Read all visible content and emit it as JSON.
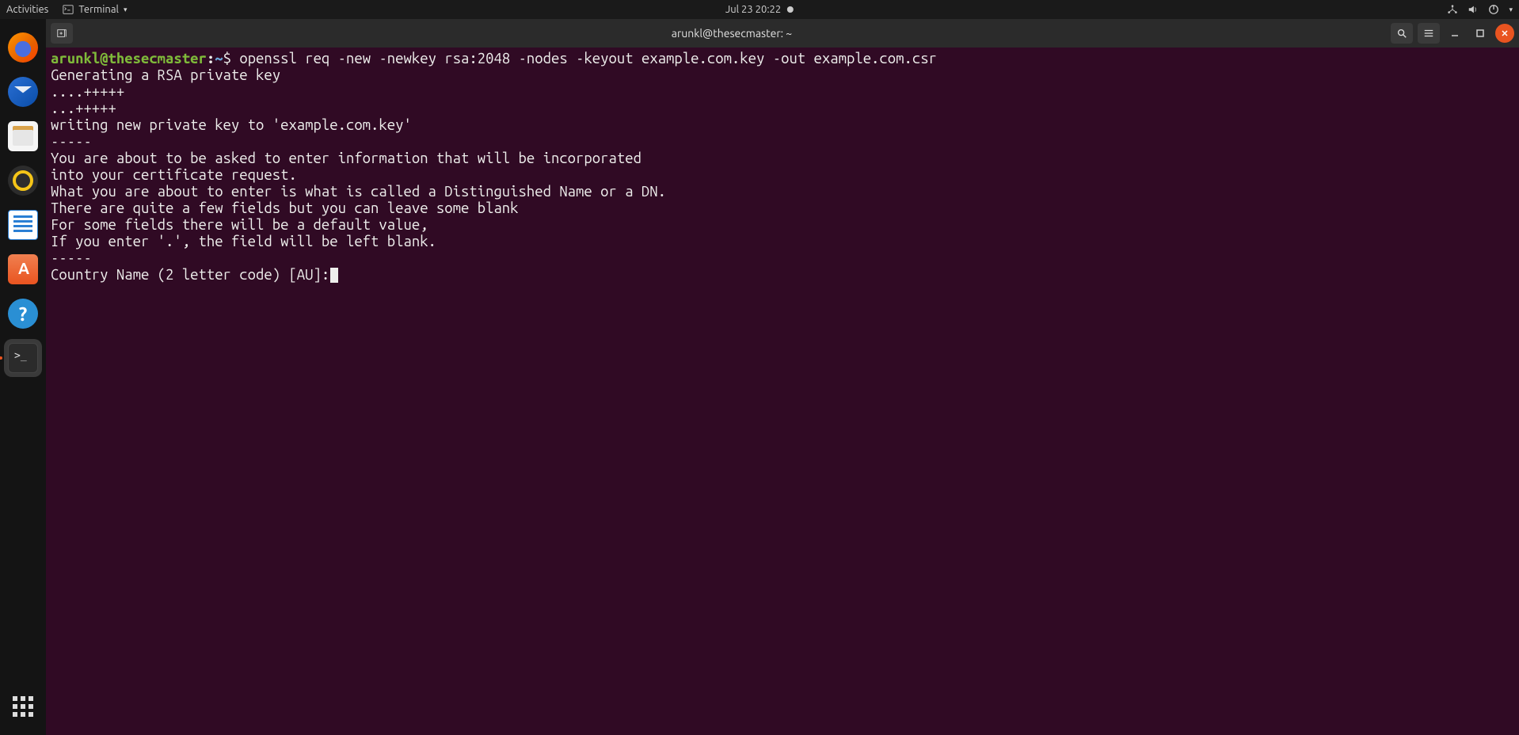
{
  "top_panel": {
    "activities": "Activities",
    "app_menu": "Terminal",
    "clock": "Jul 23  20:22"
  },
  "dock": {
    "items": [
      {
        "name": "firefox"
      },
      {
        "name": "thunderbird"
      },
      {
        "name": "files"
      },
      {
        "name": "rhythmbox"
      },
      {
        "name": "libreoffice-writer"
      },
      {
        "name": "ubuntu-software"
      },
      {
        "name": "help"
      },
      {
        "name": "terminal"
      }
    ]
  },
  "window": {
    "title": "arunkl@thesecmaster: ~"
  },
  "terminal": {
    "prompt_user": "arunkl@thesecmaster",
    "prompt_sep": ":",
    "prompt_path": "~",
    "prompt_dollar": "$ ",
    "command": "openssl req -new -newkey rsa:2048 -nodes -keyout example.com.key -out example.com.csr",
    "lines": [
      "Generating a RSA private key",
      "....+++++",
      "...+++++",
      "writing new private key to 'example.com.key'",
      "-----",
      "You are about to be asked to enter information that will be incorporated",
      "into your certificate request.",
      "What you are about to enter is what is called a Distinguished Name or a DN.",
      "There are quite a few fields but you can leave some blank",
      "For some fields there will be a default value,",
      "If you enter '.', the field will be left blank.",
      "-----",
      "Country Name (2 letter code) [AU]:"
    ]
  }
}
